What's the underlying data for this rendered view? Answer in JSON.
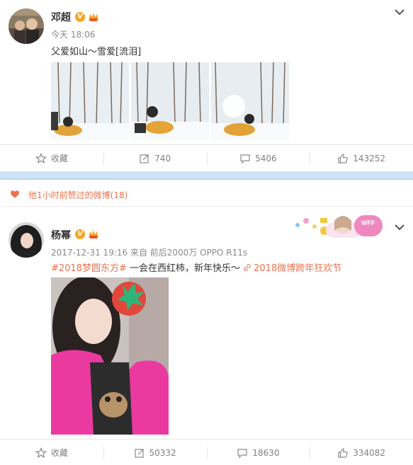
{
  "post1": {
    "author": "邓超",
    "time": "今天 18:06",
    "text": "父爱如山～雪爱[流泪]",
    "actions": {
      "favorite": "收藏",
      "repost": "740",
      "comment": "5406",
      "like": "143252"
    }
  },
  "liked_bar": {
    "text": "他1小时前赞过的微博(18)"
  },
  "post2": {
    "author": "杨幂",
    "meta": "2017-12-31 19:16 来自 前后2000万 OPPO R11s",
    "topic": "#2018梦圆东方#",
    "body": " 一会在西红柿，新年快乐～ ",
    "event_link": "2018微博跨年狂欢节",
    "badge_text": "WFF",
    "actions": {
      "favorite": "收藏",
      "repost": "50332",
      "comment": "18630",
      "like": "334082"
    }
  },
  "colors": {
    "accent": "#eb7350",
    "divider": "#cfe3f6",
    "verified": "#f6a623"
  },
  "icons": [
    "chevron-down-icon",
    "star-icon",
    "repost-icon",
    "comment-icon",
    "like-icon",
    "heart-icon",
    "verified-icon",
    "vip-icon",
    "link-icon"
  ]
}
